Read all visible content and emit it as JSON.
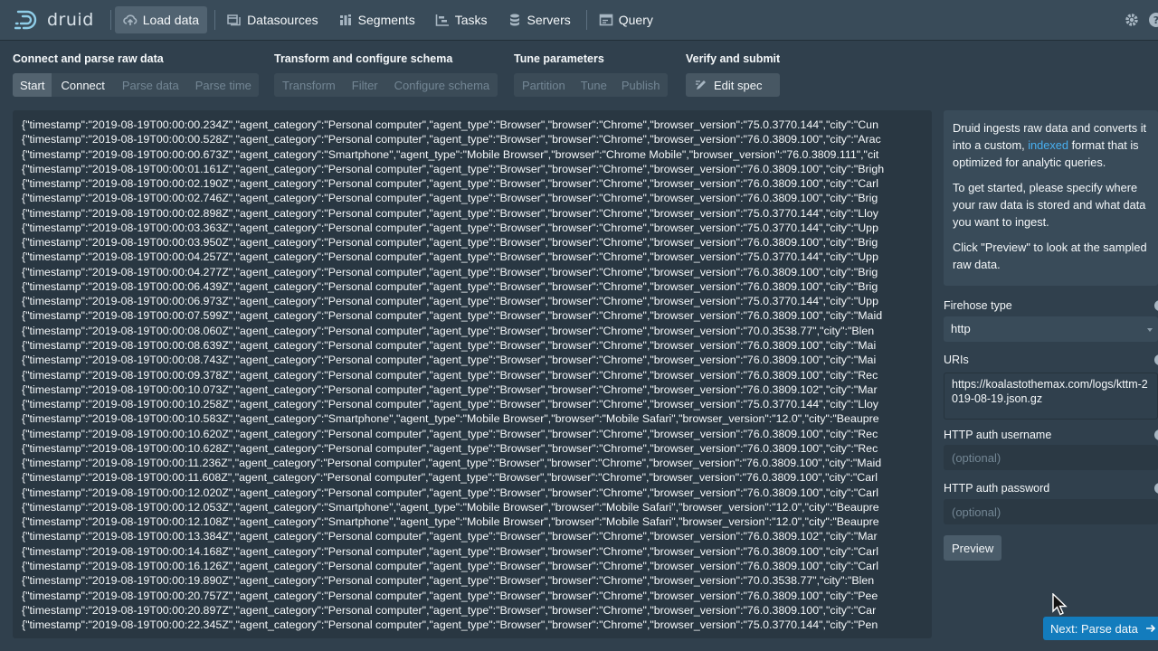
{
  "brand": {
    "name": "druid"
  },
  "nav": {
    "items": [
      {
        "label": "Load data",
        "icon": "cloud-upload-icon",
        "active": true
      },
      {
        "label": "Datasources",
        "icon": "datasources-icon",
        "active": false
      },
      {
        "label": "Segments",
        "icon": "segments-icon",
        "active": false
      },
      {
        "label": "Tasks",
        "icon": "tasks-icon",
        "active": false
      },
      {
        "label": "Servers",
        "icon": "database-icon",
        "active": false
      },
      {
        "label": "Query",
        "icon": "application-icon",
        "active": false
      }
    ],
    "right_icons": [
      "gear-icon",
      "help-icon"
    ]
  },
  "steps": {
    "connect_parse": {
      "title": "Connect and parse raw data",
      "buttons": [
        "Start",
        "Connect",
        "Parse data",
        "Parse time"
      ]
    },
    "transform": {
      "title": "Transform and configure schema",
      "buttons": [
        "Transform",
        "Filter",
        "Configure schema"
      ]
    },
    "tune": {
      "title": "Tune parameters",
      "buttons": [
        "Partition",
        "Tune",
        "Publish"
      ]
    },
    "verify": {
      "title": "Verify and submit",
      "edit_spec": "Edit spec"
    }
  },
  "raw_data": {
    "lines": [
      "{\"timestamp\":\"2019-08-19T00:00:00.234Z\",\"agent_category\":\"Personal computer\",\"agent_type\":\"Browser\",\"browser\":\"Chrome\",\"browser_version\":\"75.0.3770.144\",\"city\":\"Cun",
      "{\"timestamp\":\"2019-08-19T00:00:00.528Z\",\"agent_category\":\"Personal computer\",\"agent_type\":\"Browser\",\"browser\":\"Chrome\",\"browser_version\":\"76.0.3809.100\",\"city\":\"Arac",
      "{\"timestamp\":\"2019-08-19T00:00:00.673Z\",\"agent_category\":\"Smartphone\",\"agent_type\":\"Mobile Browser\",\"browser\":\"Chrome Mobile\",\"browser_version\":\"76.0.3809.111\",\"cit",
      "{\"timestamp\":\"2019-08-19T00:00:01.161Z\",\"agent_category\":\"Personal computer\",\"agent_type\":\"Browser\",\"browser\":\"Chrome\",\"browser_version\":\"76.0.3809.100\",\"city\":\"Brigh",
      "{\"timestamp\":\"2019-08-19T00:00:02.190Z\",\"agent_category\":\"Personal computer\",\"agent_type\":\"Browser\",\"browser\":\"Chrome\",\"browser_version\":\"76.0.3809.100\",\"city\":\"Carl",
      "{\"timestamp\":\"2019-08-19T00:00:02.746Z\",\"agent_category\":\"Personal computer\",\"agent_type\":\"Browser\",\"browser\":\"Chrome\",\"browser_version\":\"76.0.3809.100\",\"city\":\"Brig",
      "{\"timestamp\":\"2019-08-19T00:00:02.898Z\",\"agent_category\":\"Personal computer\",\"agent_type\":\"Browser\",\"browser\":\"Chrome\",\"browser_version\":\"75.0.3770.144\",\"city\":\"Lloy",
      "{\"timestamp\":\"2019-08-19T00:00:03.363Z\",\"agent_category\":\"Personal computer\",\"agent_type\":\"Browser\",\"browser\":\"Chrome\",\"browser_version\":\"75.0.3770.144\",\"city\":\"Upp",
      "{\"timestamp\":\"2019-08-19T00:00:03.950Z\",\"agent_category\":\"Personal computer\",\"agent_type\":\"Browser\",\"browser\":\"Chrome\",\"browser_version\":\"76.0.3809.100\",\"city\":\"Brig",
      "{\"timestamp\":\"2019-08-19T00:00:04.257Z\",\"agent_category\":\"Personal computer\",\"agent_type\":\"Browser\",\"browser\":\"Chrome\",\"browser_version\":\"75.0.3770.144\",\"city\":\"Upp",
      "{\"timestamp\":\"2019-08-19T00:00:04.277Z\",\"agent_category\":\"Personal computer\",\"agent_type\":\"Browser\",\"browser\":\"Chrome\",\"browser_version\":\"76.0.3809.100\",\"city\":\"Brig",
      "{\"timestamp\":\"2019-08-19T00:00:06.439Z\",\"agent_category\":\"Personal computer\",\"agent_type\":\"Browser\",\"browser\":\"Chrome\",\"browser_version\":\"76.0.3809.100\",\"city\":\"Brig",
      "{\"timestamp\":\"2019-08-19T00:00:06.973Z\",\"agent_category\":\"Personal computer\",\"agent_type\":\"Browser\",\"browser\":\"Chrome\",\"browser_version\":\"75.0.3770.144\",\"city\":\"Upp",
      "{\"timestamp\":\"2019-08-19T00:00:07.599Z\",\"agent_category\":\"Personal computer\",\"agent_type\":\"Browser\",\"browser\":\"Chrome\",\"browser_version\":\"76.0.3809.100\",\"city\":\"Maid",
      "{\"timestamp\":\"2019-08-19T00:00:08.060Z\",\"agent_category\":\"Personal computer\",\"agent_type\":\"Browser\",\"browser\":\"Chrome\",\"browser_version\":\"70.0.3538.77\",\"city\":\"Blen",
      "{\"timestamp\":\"2019-08-19T00:00:08.639Z\",\"agent_category\":\"Personal computer\",\"agent_type\":\"Browser\",\"browser\":\"Chrome\",\"browser_version\":\"76.0.3809.100\",\"city\":\"Mai",
      "{\"timestamp\":\"2019-08-19T00:00:08.743Z\",\"agent_category\":\"Personal computer\",\"agent_type\":\"Browser\",\"browser\":\"Chrome\",\"browser_version\":\"76.0.3809.100\",\"city\":\"Mai",
      "{\"timestamp\":\"2019-08-19T00:00:09.378Z\",\"agent_category\":\"Personal computer\",\"agent_type\":\"Browser\",\"browser\":\"Chrome\",\"browser_version\":\"76.0.3809.100\",\"city\":\"Rec",
      "{\"timestamp\":\"2019-08-19T00:00:10.073Z\",\"agent_category\":\"Personal computer\",\"agent_type\":\"Browser\",\"browser\":\"Chrome\",\"browser_version\":\"76.0.3809.102\",\"city\":\"Mar",
      "{\"timestamp\":\"2019-08-19T00:00:10.258Z\",\"agent_category\":\"Personal computer\",\"agent_type\":\"Browser\",\"browser\":\"Chrome\",\"browser_version\":\"75.0.3770.144\",\"city\":\"Lloy",
      "{\"timestamp\":\"2019-08-19T00:00:10.583Z\",\"agent_category\":\"Smartphone\",\"agent_type\":\"Mobile Browser\",\"browser\":\"Mobile Safari\",\"browser_version\":\"12.0\",\"city\":\"Beaupre",
      "{\"timestamp\":\"2019-08-19T00:00:10.620Z\",\"agent_category\":\"Personal computer\",\"agent_type\":\"Browser\",\"browser\":\"Chrome\",\"browser_version\":\"76.0.3809.100\",\"city\":\"Rec",
      "{\"timestamp\":\"2019-08-19T00:00:10.628Z\",\"agent_category\":\"Personal computer\",\"agent_type\":\"Browser\",\"browser\":\"Chrome\",\"browser_version\":\"76.0.3809.100\",\"city\":\"Rec",
      "{\"timestamp\":\"2019-08-19T00:00:11.236Z\",\"agent_category\":\"Personal computer\",\"agent_type\":\"Browser\",\"browser\":\"Chrome\",\"browser_version\":\"76.0.3809.100\",\"city\":\"Maid",
      "{\"timestamp\":\"2019-08-19T00:00:11.608Z\",\"agent_category\":\"Personal computer\",\"agent_type\":\"Browser\",\"browser\":\"Chrome\",\"browser_version\":\"76.0.3809.100\",\"city\":\"Carl",
      "{\"timestamp\":\"2019-08-19T00:00:12.020Z\",\"agent_category\":\"Personal computer\",\"agent_type\":\"Browser\",\"browser\":\"Chrome\",\"browser_version\":\"76.0.3809.100\",\"city\":\"Carl",
      "{\"timestamp\":\"2019-08-19T00:00:12.053Z\",\"agent_category\":\"Smartphone\",\"agent_type\":\"Mobile Browser\",\"browser\":\"Mobile Safari\",\"browser_version\":\"12.0\",\"city\":\"Beaupre",
      "{\"timestamp\":\"2019-08-19T00:00:12.108Z\",\"agent_category\":\"Smartphone\",\"agent_type\":\"Mobile Browser\",\"browser\":\"Mobile Safari\",\"browser_version\":\"12.0\",\"city\":\"Beaupre",
      "{\"timestamp\":\"2019-08-19T00:00:13.384Z\",\"agent_category\":\"Personal computer\",\"agent_type\":\"Browser\",\"browser\":\"Chrome\",\"browser_version\":\"76.0.3809.102\",\"city\":\"Mar",
      "{\"timestamp\":\"2019-08-19T00:00:14.168Z\",\"agent_category\":\"Personal computer\",\"agent_type\":\"Browser\",\"browser\":\"Chrome\",\"browser_version\":\"76.0.3809.100\",\"city\":\"Carl",
      "{\"timestamp\":\"2019-08-19T00:00:16.126Z\",\"agent_category\":\"Personal computer\",\"agent_type\":\"Browser\",\"browser\":\"Chrome\",\"browser_version\":\"76.0.3809.100\",\"city\":\"Carl",
      "{\"timestamp\":\"2019-08-19T00:00:19.890Z\",\"agent_category\":\"Personal computer\",\"agent_type\":\"Browser\",\"browser\":\"Chrome\",\"browser_version\":\"70.0.3538.77\",\"city\":\"Blen",
      "{\"timestamp\":\"2019-08-19T00:00:20.757Z\",\"agent_category\":\"Personal computer\",\"agent_type\":\"Browser\",\"browser\":\"Chrome\",\"browser_version\":\"76.0.3809.100\",\"city\":\"Pee",
      "{\"timestamp\":\"2019-08-19T00:00:20.897Z\",\"agent_category\":\"Personal computer\",\"agent_type\":\"Browser\",\"browser\":\"Chrome\",\"browser_version\":\"76.0.3809.100\",\"city\":\"Car",
      "{\"timestamp\":\"2019-08-19T00:00:22.345Z\",\"agent_category\":\"Personal computer\",\"agent_type\":\"Browser\",\"browser\":\"Chrome\",\"browser_version\":\"75.0.3770.144\",\"city\":\"Pen"
    ]
  },
  "side": {
    "info_text_1_before": "Druid ingests raw data and converts it into a custom, ",
    "info_link": "indexed",
    "info_text_1_after": " format that is optimized for analytic queries.",
    "info_text_2": "To get started, please specify where your raw data is stored and what data you want to ingest.",
    "info_text_3": "Click \"Preview\" to look at the sampled raw data.",
    "firehose_label": "Firehose type",
    "firehose_value": "http",
    "uris_label": "URIs",
    "uris_value": "https://koalastothemax.com/logs/kttm-2019-08-19.json.gz",
    "username_label": "HTTP auth username",
    "username_placeholder": "(optional)",
    "password_label": "HTTP auth password",
    "password_placeholder": "(optional)",
    "preview_label": "Preview"
  },
  "next_button": {
    "label": "Next: Parse data",
    "icon": "arrow-right-icon"
  },
  "colors": {
    "accent": "#137cbd",
    "link": "#48aff0",
    "background": "#30404d",
    "nav": "#394b59"
  }
}
